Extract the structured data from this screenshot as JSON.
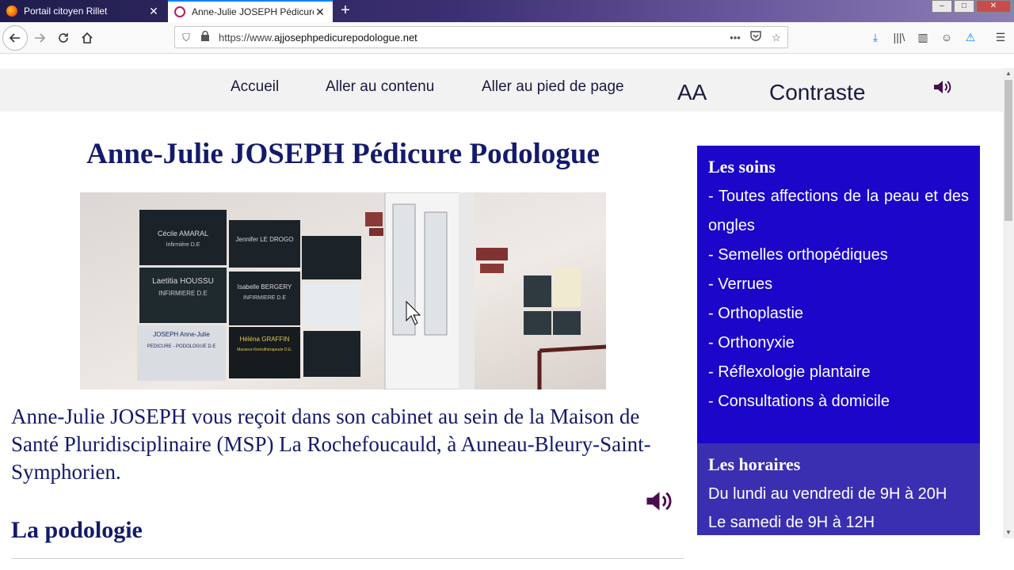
{
  "browser": {
    "tabs": [
      {
        "title": "Portail citoyen Rillet",
        "active": false
      },
      {
        "title": "Anne-Julie JOSEPH Pédicure Po",
        "active": true
      }
    ],
    "url_scheme": "https://www.",
    "url_host": "ajjosephpedicurepodologue.net"
  },
  "site_nav": {
    "accueil": "Accueil",
    "contenu": "Aller au contenu",
    "pied": "Aller au pied de page",
    "text_size": "AA",
    "contrast": "Contraste"
  },
  "main": {
    "title": "Anne-Julie JOSEPH Pédicure Podologue",
    "intro": "Anne-Julie JOSEPH vous reçoit dans son cabinet au sein de la Maison de Santé Pluridisciplinaire (MSP) La Rochefoucauld, à Auneau-Bleury-Saint-Symphorien.",
    "section_title": "La podologie"
  },
  "photo_plaques": [
    {
      "name": "Cécile AMARAL",
      "role": "Infirmière D.E"
    },
    {
      "name": "Jennifer LE DROGO",
      "role": ""
    },
    {
      "name": "Laetitia HOUSSU",
      "role": "INFIRMIERE D.E"
    },
    {
      "name": "Isabelle BERGERY",
      "role": "INFIRMIERE D.E"
    },
    {
      "name": "JOSEPH Anne-Julie",
      "role": "PEDICURE - PODOLOGUE D.E"
    },
    {
      "name": "Héléna GRAFFIN",
      "role": "Masseur-Kinésithérapeute D.E."
    }
  ],
  "sidebar": {
    "soins_title": "Les soins",
    "soins_items": [
      "- Toutes affections de la peau et des ongles",
      "- Semelles orthopédiques",
      "- Verrues",
      "- Orthoplastie",
      "- Orthonyxie",
      "- Réflexologie plantaire",
      "- Consultations à domicile"
    ],
    "horaires_title": "Les horaires",
    "horaires_lines": [
      "Du lundi au vendredi de 9H à 20H",
      "Le samedi de 9H à 12H"
    ]
  },
  "colors": {
    "soins_bg": "#1c06c9",
    "horaires_bg": "#3a2fb0",
    "title_text": "#141a6b",
    "speaker_icon": "#4a0d4d"
  }
}
